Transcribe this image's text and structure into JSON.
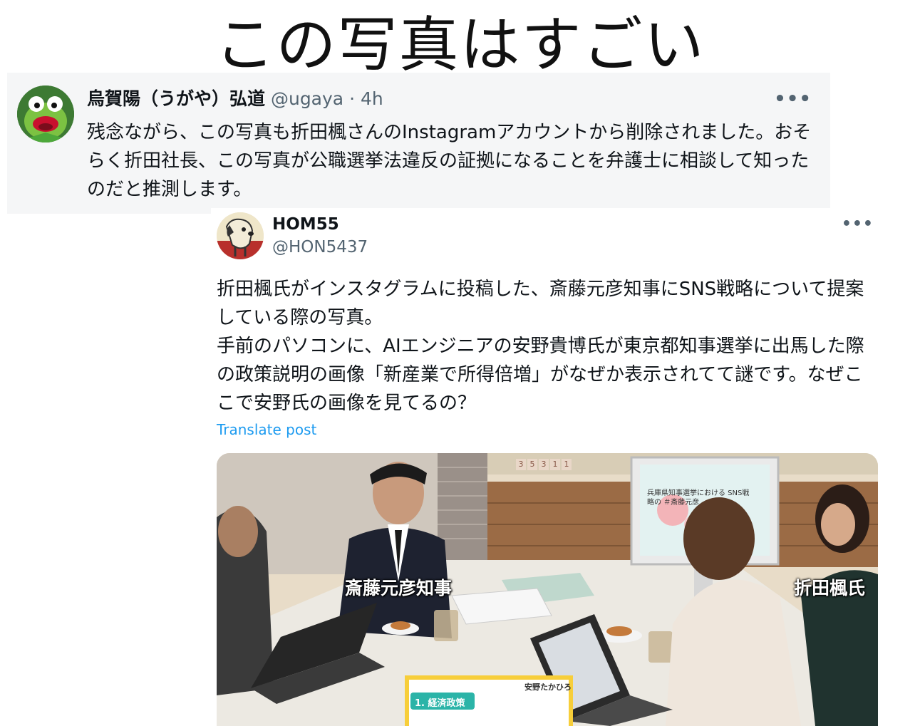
{
  "headline": "この写真はすごい",
  "tweet1": {
    "display_name": "烏賀陽（うがや）弘道",
    "handle": "@ugaya",
    "separator": "·",
    "time": "4h",
    "more_icon": "more-dots-icon",
    "text": "残念ながら、この写真も折田楓さんのInstagramアカウントから削除されました。おそらく折田社長、この写真が公職選挙法違反の証拠になることを弁護士に相談して知ったのだと推測します。"
  },
  "tweet2": {
    "display_name": "HOM55",
    "handle": "@HON5437",
    "more_icon": "more-dots-icon",
    "paragraph1": "折田楓氏がインスタグラムに投稿した、斎藤元彦知事にSNS戦略について提案している際の写真。",
    "paragraph2": "手前のパソコンに、AIエンジニアの安野貴博氏が東京都知事選挙に出馬した際の政策説明の画像「新産業で所得倍増」がなぜか表示されてて謎です。なぜここで安野氏の画像を見てるの？",
    "translate": "Translate post",
    "photo": {
      "label_left": "斎藤元彦知事",
      "label_right": "折田楓氏",
      "counter": [
        "3",
        "5",
        "3",
        "1",
        "1"
      ],
      "monitor_text": "兵庫県知事選挙における SNS戦略の ＃斎藤元彦",
      "card_name": "安野たかひろ",
      "card_section": "1. 経済政策"
    }
  }
}
